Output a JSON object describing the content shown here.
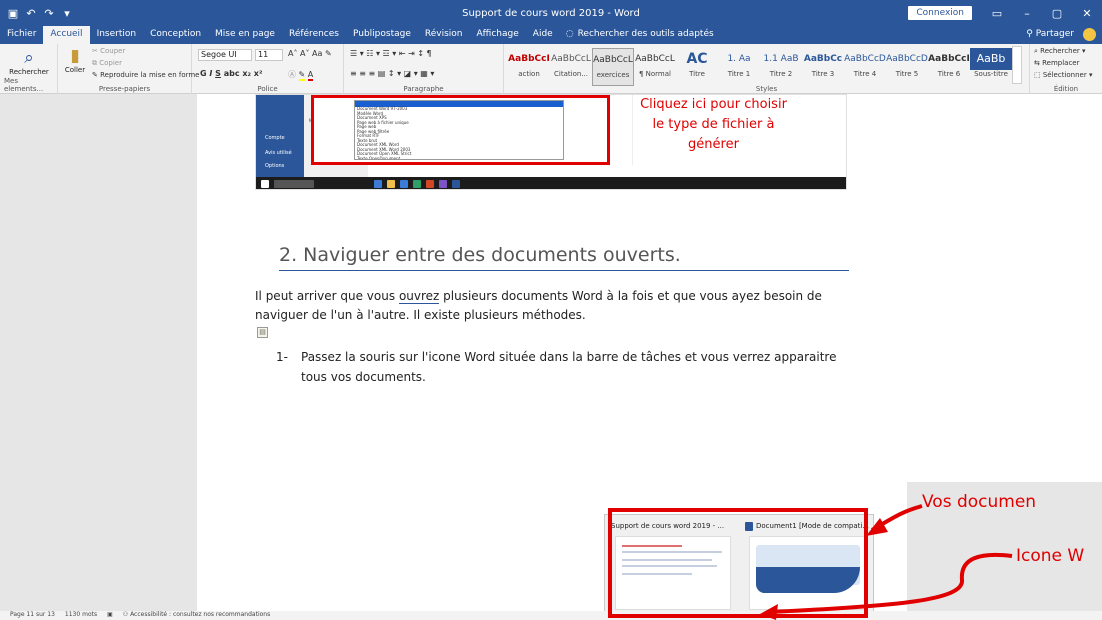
{
  "window": {
    "title": "Support de cours word 2019 - Word",
    "connexion_label": "Connexion",
    "share_label": "Partager",
    "search_tab": "Rechercher des outils adaptés"
  },
  "tabs": [
    "Fichier",
    "Accueil",
    "Insertion",
    "Conception",
    "Mise en page",
    "Références",
    "Publipostage",
    "Révision",
    "Affichage",
    "Aide"
  ],
  "ribbon": {
    "rechercher": "Rechercher",
    "mes_elements": "Mes elements...",
    "clipboard": {
      "label": "Presse-papiers",
      "coller": "Coller",
      "couper": "Couper",
      "copier": "Copier",
      "reproduire": "Reproduire la mise en forme"
    },
    "police": {
      "label": "Police",
      "font": "Segoe UI",
      "size": "11"
    },
    "paragraphe": {
      "label": "Paragraphe"
    },
    "styles": {
      "label": "Styles",
      "items": [
        {
          "preview": "AaBbCcI",
          "name": "action",
          "color": "#c00000"
        },
        {
          "preview": "AaBbCcL",
          "name": "Citation...",
          "color": "#555555"
        },
        {
          "preview": "AaBbCcL",
          "name": "exercices",
          "color": "#333333"
        },
        {
          "preview": "AaBbCcL",
          "name": "¶ Normal",
          "color": "#333333"
        },
        {
          "preview": "AC",
          "name": "Titre",
          "color": "#2b579a"
        },
        {
          "preview": "1. Aa",
          "name": "Titre 1",
          "color": "#2b579a"
        },
        {
          "preview": "1.1 AaB",
          "name": "Titre 2",
          "color": "#2b579a"
        },
        {
          "preview": "AaBbCc",
          "name": "Titre 3",
          "color": "#2b579a"
        },
        {
          "preview": "AaBbCcD",
          "name": "Titre 4",
          "color": "#2b579a"
        },
        {
          "preview": "AaBbCcD",
          "name": "Titre 5",
          "color": "#2b579a"
        },
        {
          "preview": "AaBbCcI",
          "name": "Titre 6",
          "color": "#333333"
        },
        {
          "preview": "AaBb",
          "name": "Sous-titre",
          "color": "#ffffff"
        }
      ]
    },
    "edition": {
      "label": "Édition",
      "rechercher": "Rechercher",
      "remplacer": "Remplacer",
      "selectionner": "Sélectionner"
    }
  },
  "screenshot": {
    "callout": [
      "Cliquez ici pour choisir",
      "le type de fichier à",
      "générer"
    ],
    "side_items": [
      "Compte",
      "Avis utilisé",
      "Options"
    ],
    "left_tag": "Masquer les dossiers",
    "file_types": [
      "Document Word 97-2003",
      "Modèle Word",
      "Document XPS",
      "Page web à fichier unique",
      "Page web",
      "Page web filtrée",
      "Format RTF",
      "Texte brut",
      "Document XML Word",
      "Document XML Word 2003",
      "Document Open XML Strict",
      "Texte OpenDocument",
      "Document Works 6 - 9"
    ]
  },
  "document": {
    "heading": "2. Naviguer entre des documents ouverts.",
    "para_before": "Il peut arriver que vous ",
    "para_underline": "ouvrez",
    "para_after": " plusieurs documents Word à la fois et que vous ayez besoin de naviguer de l'un à l'autre. Il existe plusieurs méthodes.",
    "list_num": "1-",
    "list_text": "Passez la souris sur l'icone Word située dans la barre de tâches et vous verrez apparaitre tous vos documents."
  },
  "thumbnails": [
    {
      "title": "Support de cours word 2019 - ..."
    },
    {
      "title": "Document1 [Mode de compati..."
    }
  ],
  "annotations": {
    "docs_label": "Vos documen",
    "icon_label": "Icone W"
  },
  "status": {
    "page": "Page 11 sur 13",
    "words": "1130 mots",
    "accessibility": "Accessibilité : consultez nos recommandations"
  },
  "taskbar": {
    "search": "Rechercher"
  }
}
